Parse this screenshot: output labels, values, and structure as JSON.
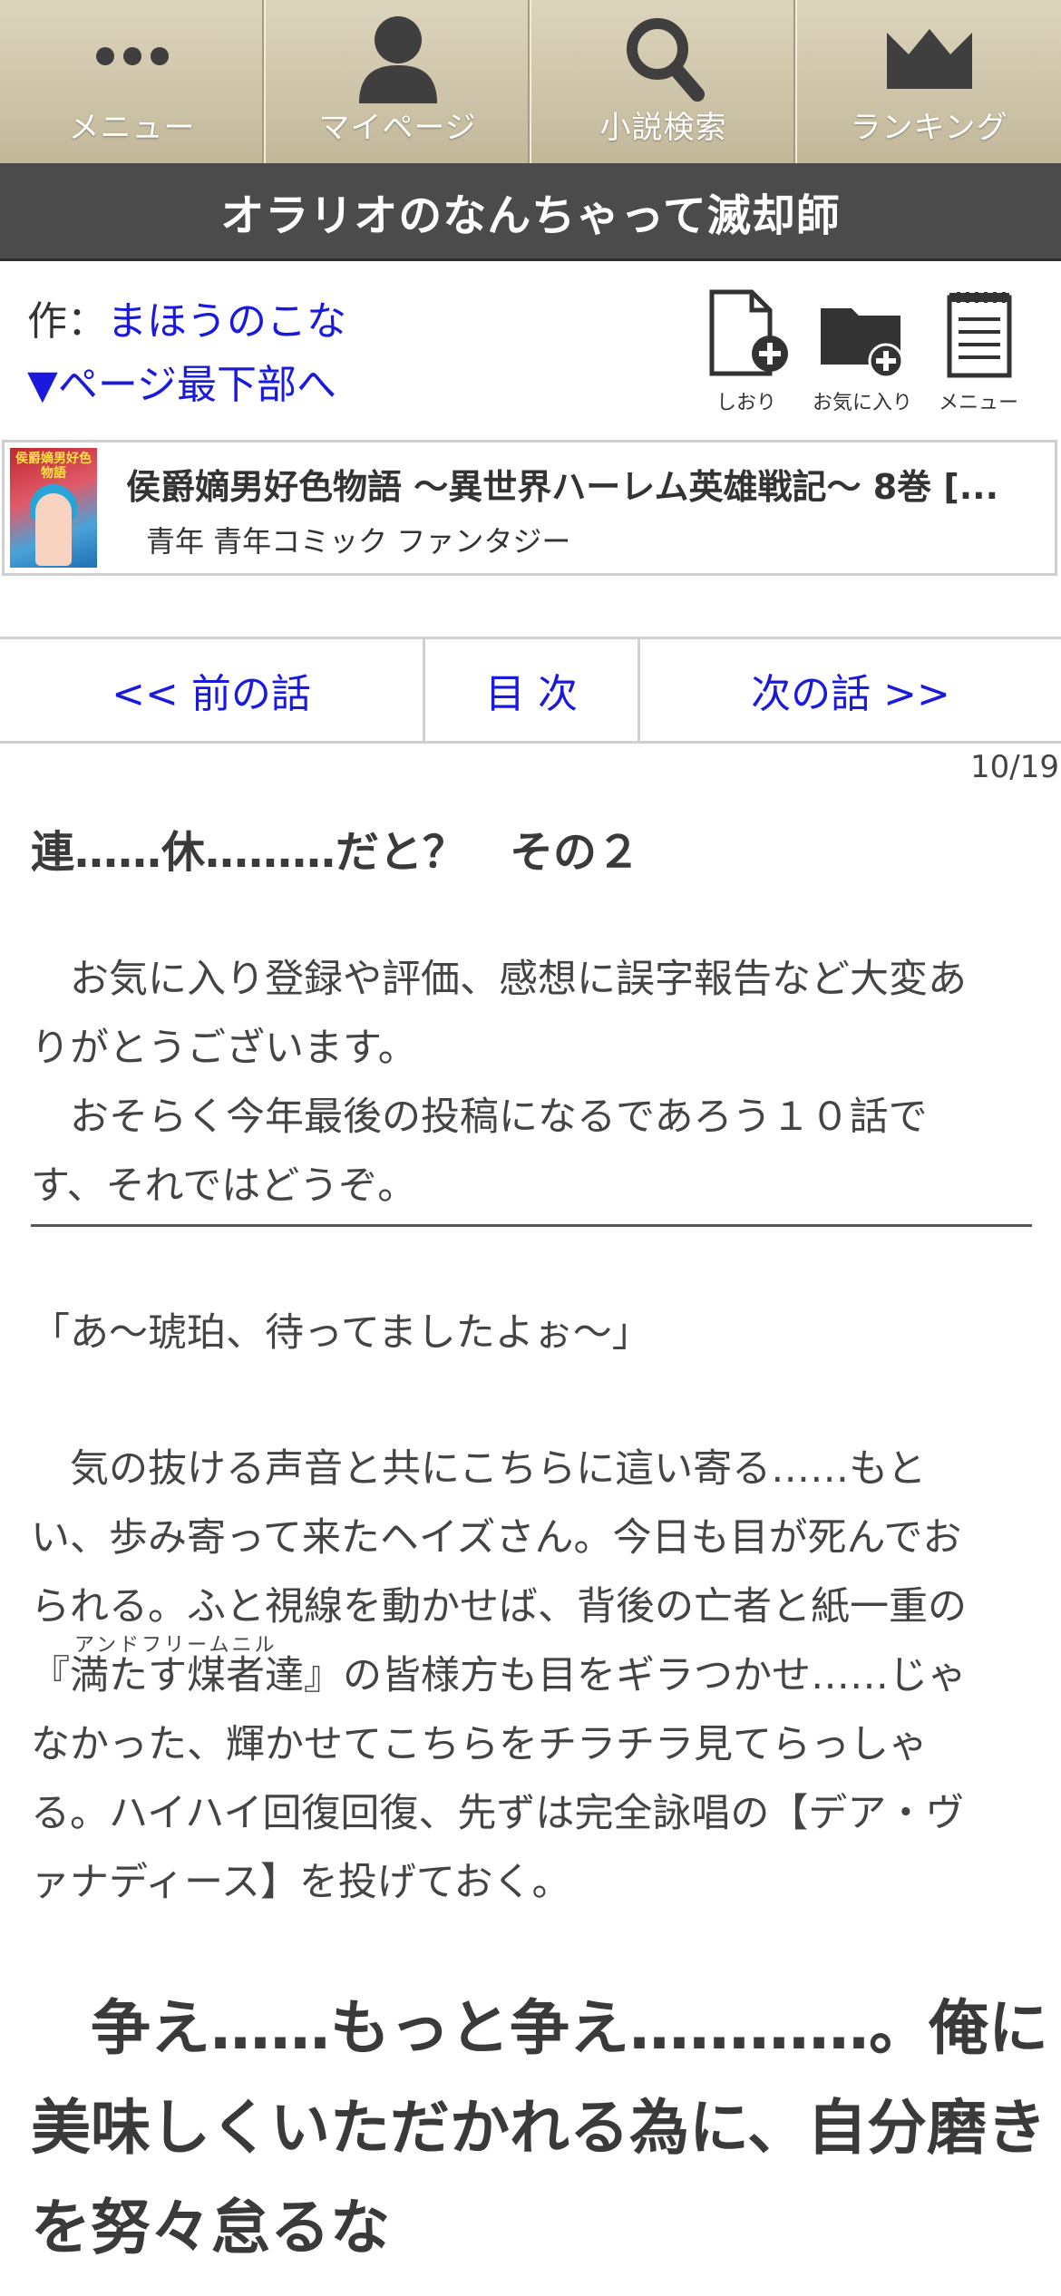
{
  "nav": {
    "items": [
      {
        "label": "メニュー",
        "icon": "dots-icon"
      },
      {
        "label": "マイページ",
        "icon": "user-icon"
      },
      {
        "label": "小説検索",
        "icon": "search-icon"
      },
      {
        "label": "ランキング",
        "icon": "crown-icon"
      }
    ]
  },
  "novel": {
    "title": "オラリオのなんちゃって滅却師",
    "author_prefix": "作：",
    "author": "まほうのこな",
    "to_bottom": "▼ページ最下部へ"
  },
  "tools": {
    "bookmark": "しおり",
    "favorite": "お気に入り",
    "menu": "メニュー"
  },
  "banner": {
    "cover_text": "侯爵嫡男好色物語",
    "title": "侯爵嫡男好色物語 ～異世界ハーレム英雄戦記～ 8巻 [...",
    "tags": "青年 青年コミック ファンタジー"
  },
  "chapter_nav": {
    "prev": "<< 前の話",
    "toc": "目 次",
    "next": "次の話 >>",
    "page": "10/19"
  },
  "content": {
    "chapter_title": "連……休………だと？　その２",
    "preface": [
      "　お気に入り登録や評価、感想に誤字報告など大変あ",
      "りがとうございます。",
      "　おそらく今年最後の投稿になるであろう１０話で",
      "す、それではどうぞ。"
    ],
    "quote": "「あ～琥珀、待ってましたよぉ～」",
    "body": [
      "　気の抜ける声音と共にこちらに這い寄る……もと",
      "い、歩み寄って来たヘイズさん。今日も目が死んでお",
      "られる。ふと視線を動かせば、背後の亡者と紙一重の",
      "『満たす煤者達』の皆様方も目をギラつかせ……じゃ",
      "なかった、輝かせてこちらをチラチラ見てらっしゃ",
      "る。ハイハイ回復回復、先ずは完全詠唱の【デア・ヴ",
      "ァナディース】を投げておく。"
    ],
    "ruby": "アンドフリームニル",
    "emphasis": [
      "　争え……もっと争え…………。俺に",
      "美味しくいただかれる為に、自分磨き",
      "を努々怠るな"
    ]
  }
}
